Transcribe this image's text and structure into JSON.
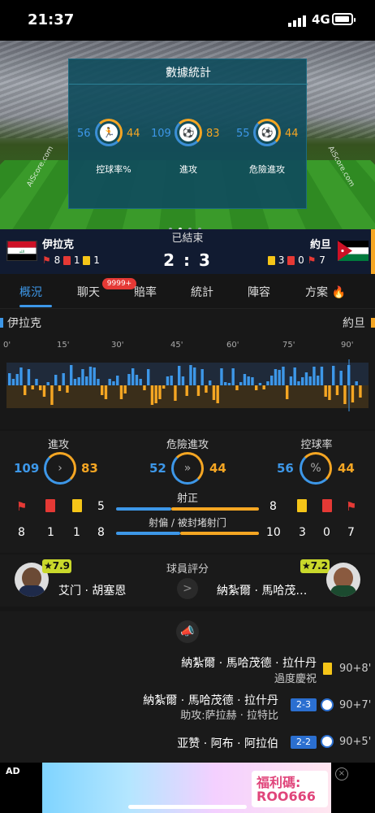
{
  "status": {
    "time": "21:37",
    "network": "4G"
  },
  "panel": {
    "title": "數據統計",
    "items": [
      {
        "left": "56",
        "right": "44",
        "label": "控球率%"
      },
      {
        "left": "109",
        "right": "83",
        "label": "進攻"
      },
      {
        "left": "55",
        "right": "44",
        "label": "危險進攻"
      }
    ],
    "watermark": "AiScore.com"
  },
  "match": {
    "status": "已結束",
    "home": "伊拉克",
    "away": "約旦",
    "score": "2 : 3",
    "home_corners": "8",
    "home_red": "1",
    "home_yellow": "1",
    "away_yellow": "3",
    "away_red": "0",
    "away_corners": "7"
  },
  "tabs": [
    {
      "label": "概況"
    },
    {
      "label": "聊天"
    },
    {
      "label": "賠率"
    },
    {
      "label": "統計"
    },
    {
      "label": "陣容"
    },
    {
      "label": "方案"
    }
  ],
  "chat_badge": "9999+",
  "timeline": {
    "home": "伊拉克",
    "away": "約旦",
    "ticks": [
      "0'",
      "15'",
      "30'",
      "45'",
      "60'",
      "75'",
      "90'"
    ]
  },
  "stats": {
    "attack": {
      "label": "進攻",
      "home": "109",
      "away": "83"
    },
    "danger": {
      "label": "危險進攻",
      "home": "52",
      "away": "44"
    },
    "possession": {
      "label": "控球率",
      "home": "56",
      "away": "44"
    },
    "shots_on": {
      "label": "射正",
      "home": "5",
      "away": "8"
    },
    "shots_off": {
      "label": "射偏 / 被封堵射门",
      "home": "8",
      "away": "10"
    },
    "home_corners": "8",
    "home_red": "1",
    "home_yellow": "1",
    "away_yellow": "3",
    "away_red": "0",
    "away_corners": "7",
    "possession_icon": "%"
  },
  "ratings": {
    "title": "球員評分",
    "home_player": "艾门 · 胡塞恩",
    "home_rating": "★7.9",
    "away_player": "納紮爾 · 馬哈茂…",
    "away_rating": "★7.2",
    "arrow": ">"
  },
  "events": [
    {
      "name": "納紮爾 · 馬哈茂德 · 拉什丹",
      "sub": "過度慶祝",
      "minute": "90+8'"
    },
    {
      "name": "納紮爾 · 馬哈茂德 · 拉什丹",
      "sub": "助攻:萨拉赫 · 拉特比",
      "score": "2-3",
      "minute": "90+7'"
    },
    {
      "name": "亚赞 · 阿布 · 阿拉伯",
      "score": "2-2",
      "minute": "90+5'"
    }
  ],
  "ad": {
    "label": "AD",
    "line1": "福利碼:",
    "line2": "ROO666"
  },
  "colors": {
    "home": "#3d97e8",
    "away": "#f5a623",
    "accent": "#3d97e8"
  }
}
